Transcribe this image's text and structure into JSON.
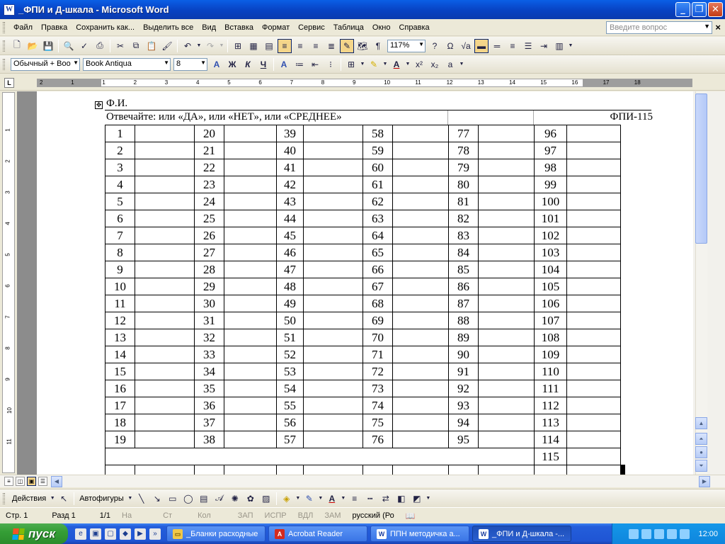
{
  "window": {
    "title": "_ФПИ и Д-шкала - Microsoft Word",
    "icon_letter": "W"
  },
  "menu": {
    "items": [
      "Файл",
      "Правка",
      "Сохранить как...",
      "Выделить все",
      "Вид",
      "Вставка",
      "Формат",
      "Сервис",
      "Таблица",
      "Окно",
      "Справка"
    ],
    "help_placeholder": "Введите вопрос"
  },
  "toolbar": {
    "zoom": "117%"
  },
  "format_bar": {
    "style": "Обычный + Воо",
    "font": "Book Antiqua",
    "size": "8",
    "bold": "Ж",
    "italic": "К",
    "underline": "Ч"
  },
  "ruler": {
    "numbers": [
      "2",
      "1",
      "1",
      "2",
      "3",
      "4",
      "5",
      "6",
      "7",
      "8",
      "9",
      "10",
      "11",
      "12",
      "13",
      "14",
      "15",
      "16",
      "17",
      "18"
    ]
  },
  "vruler": {
    "numbers": [
      "1",
      "2",
      "3",
      "4",
      "5",
      "6",
      "7",
      "8",
      "9",
      "10",
      "11"
    ]
  },
  "document": {
    "name_label": "Ф.И.",
    "instruction": "Отвечайте: или «ДА», или «НЕТ»,  или «СРЕДНЕЕ»",
    "form_code": "ФПИ-115",
    "columns": [
      [
        "1",
        "2",
        "3",
        "4",
        "5",
        "6",
        "7",
        "8",
        "9",
        "10",
        "11",
        "12",
        "13",
        "14",
        "15",
        "16",
        "17",
        "18",
        "19"
      ],
      [
        "20",
        "21",
        "22",
        "23",
        "24",
        "25",
        "26",
        "27",
        "28",
        "29",
        "30",
        "31",
        "32",
        "33",
        "34",
        "35",
        "36",
        "37",
        "38"
      ],
      [
        "39",
        "40",
        "41",
        "42",
        "43",
        "44",
        "45",
        "46",
        "47",
        "48",
        "49",
        "50",
        "51",
        "52",
        "53",
        "54",
        "55",
        "56",
        "57"
      ],
      [
        "58",
        "59",
        "60",
        "61",
        "62",
        "63",
        "64",
        "65",
        "66",
        "67",
        "68",
        "69",
        "70",
        "71",
        "72",
        "73",
        "74",
        "75",
        "76"
      ],
      [
        "77",
        "78",
        "79",
        "80",
        "81",
        "82",
        "83",
        "84",
        "85",
        "86",
        "87",
        "88",
        "89",
        "90",
        "91",
        "92",
        "93",
        "94",
        "95"
      ],
      [
        "96",
        "97",
        "98",
        "99",
        "100",
        "101",
        "102",
        "103",
        "104",
        "105",
        "106",
        "107",
        "108",
        "109",
        "110",
        "111",
        "112",
        "113",
        "114"
      ]
    ],
    "last_number": "115"
  },
  "drawbar": {
    "actions": "Действия",
    "autoshapes": "Автофигуры"
  },
  "status": {
    "page": "Стр.  1",
    "section": "Разд  1",
    "pages": "1/1",
    "at": "На",
    "line": "Ст",
    "col": "Кол",
    "rec": "ЗАП",
    "trk": "ИСПР",
    "ext": "ВДЛ",
    "ovr": "ЗАМ",
    "lang": "русский (Ро"
  },
  "taskbar": {
    "start": "пуск",
    "tasks": [
      {
        "label": "_Бланки расходные",
        "icon": "folder-icon"
      },
      {
        "label": "Acrobat Reader",
        "icon": "acrobat-icon"
      },
      {
        "label": "ППН методичка а...",
        "icon": "word-icon"
      },
      {
        "label": "_ФПИ и Д-шкала -...",
        "icon": "word-icon"
      }
    ],
    "clock": "12:00"
  },
  "colors": {
    "titlebar": "#0842c2",
    "taskbar": "#245edb",
    "start": "#359e36"
  }
}
